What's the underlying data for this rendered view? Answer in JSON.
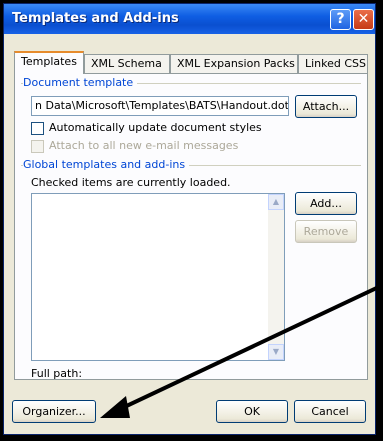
{
  "window": {
    "title": "Templates and Add-ins",
    "help_label": "?",
    "close_label": "✕"
  },
  "tabs": [
    {
      "label": "Templates",
      "active": true
    },
    {
      "label": "XML Schema",
      "active": false
    },
    {
      "label": "XML Expansion Packs",
      "active": false
    },
    {
      "label": "Linked CSS",
      "active": false
    }
  ],
  "document_template": {
    "group_label": "Document template",
    "path_value": "n Data\\Microsoft\\Templates\\BATS\\Handout.dot",
    "attach_label": "Attach...",
    "auto_update_label": "Automatically update document styles",
    "auto_update_checked": false,
    "attach_email_label": "Attach to all new e-mail messages",
    "attach_email_enabled": false
  },
  "global_templates": {
    "group_label": "Global templates and add-ins",
    "info_text": "Checked items are currently loaded.",
    "add_label": "Add...",
    "remove_label": "Remove",
    "items": []
  },
  "full_path_label": "Full path:",
  "footer": {
    "organizer_label": "Organizer...",
    "ok_label": "OK",
    "cancel_label": "Cancel"
  },
  "colors": {
    "titlebar": "#0a4fd0",
    "group_label": "#0046d5",
    "dialog_bg": "#ece9d8",
    "annotation_arrow": "#000000"
  }
}
